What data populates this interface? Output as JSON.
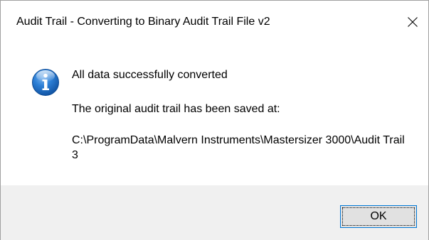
{
  "dialog": {
    "title": "Audit Trail - Converting to Binary Audit Trail File v2",
    "close_symbol": "✕",
    "icon": "info-icon",
    "messages": {
      "line1": "All data successfully converted",
      "line2": "The original audit trail has been saved at:",
      "line3": "C:\\ProgramData\\Malvern Instruments\\Mastersizer 3000\\Audit Trail 3"
    },
    "ok_label": "OK"
  },
  "colors": {
    "icon_blue": "#1f6fc8",
    "focus_border": "#0078d7",
    "footer_bg": "#f0f0f0",
    "button_bg": "#e1e1e1"
  }
}
